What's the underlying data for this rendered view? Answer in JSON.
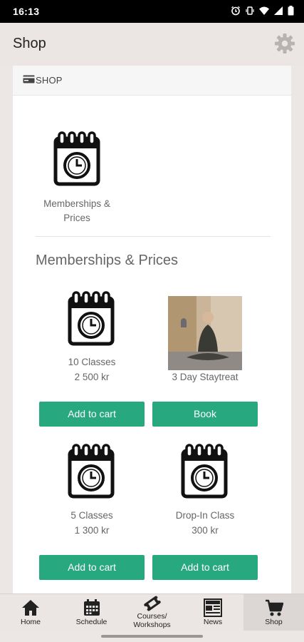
{
  "status_bar": {
    "time": "16:13"
  },
  "app_bar": {
    "title": "Shop"
  },
  "card": {
    "header_label": "SHOP",
    "category": {
      "label_line1": "Memberships &",
      "label_line2": "Prices"
    },
    "section_title": "Memberships & Prices"
  },
  "products": [
    {
      "name": "10 Classes",
      "price": "2 500 kr",
      "button": "Add to cart",
      "image": "calendar-clock-icon"
    },
    {
      "name": "3 Day Staytreat",
      "price": "",
      "button": "Book",
      "image": "meditation-photo"
    },
    {
      "name": "5 Classes",
      "price": "1 300 kr",
      "button": "Add to cart",
      "image": "calendar-clock-icon"
    },
    {
      "name": "Drop-In Class",
      "price": "300 kr",
      "button": "Add to cart",
      "image": "calendar-clock-icon"
    }
  ],
  "bottom_nav": {
    "items": [
      {
        "label": "Home",
        "icon": "home-icon"
      },
      {
        "label": "Schedule",
        "icon": "calendar-icon"
      },
      {
        "label_line1": "Courses/",
        "label_line2": "Workshops",
        "icon": "ticket-icon"
      },
      {
        "label": "News",
        "icon": "newspaper-icon"
      },
      {
        "label": "Shop",
        "icon": "cart-icon"
      }
    ],
    "active": "Shop"
  },
  "colors": {
    "accent": "#28a87e",
    "app_bar": "#ebe5e3",
    "background": "#ece7e5"
  }
}
